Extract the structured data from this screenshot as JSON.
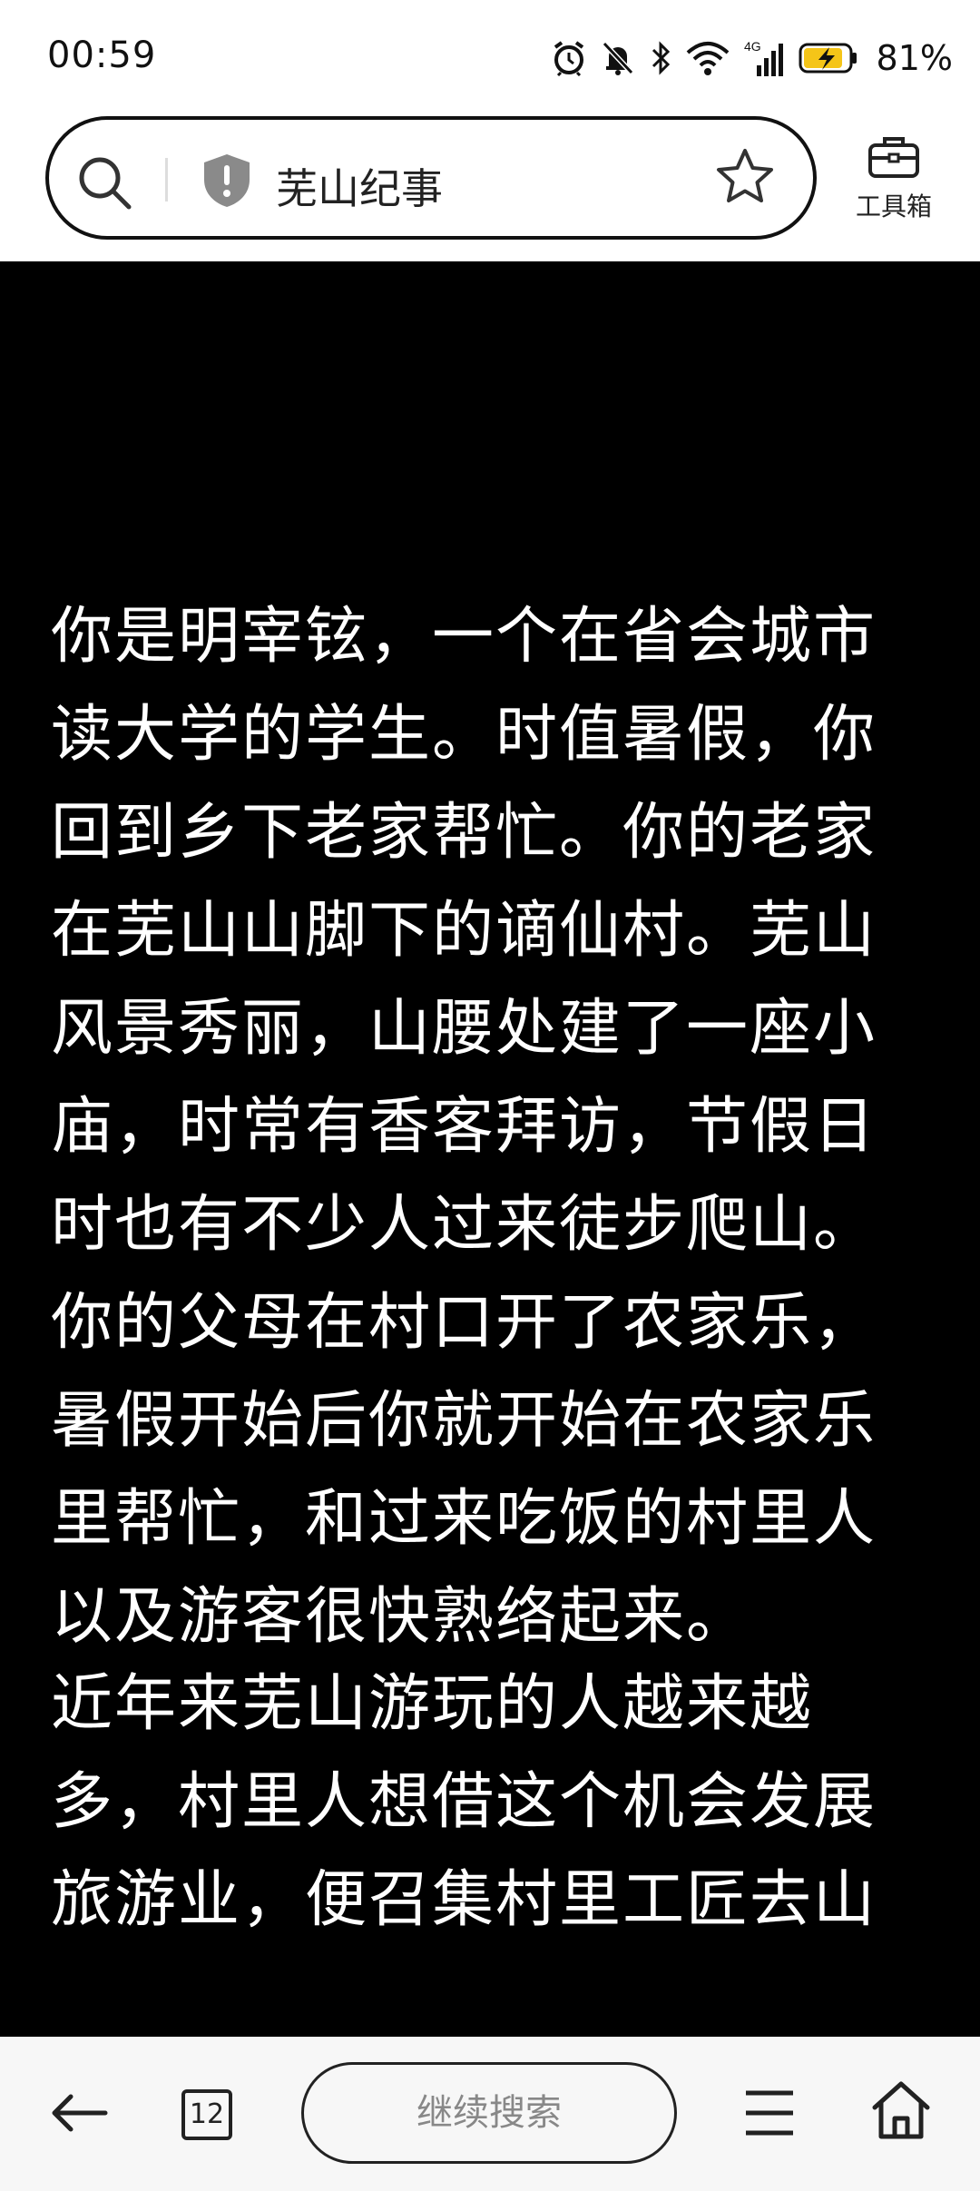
{
  "status_bar": {
    "time": "00:59",
    "network": "4G",
    "battery_percent": "81%"
  },
  "address_bar": {
    "page_title": "芜山纪事",
    "toolbox_label": "工具箱"
  },
  "article": {
    "paragraphs": [
      "你是明宰铉，一个在省会城市读大学的学生。时值暑假，你回到乡下老家帮忙。你的老家在芜山山脚下的谪仙村。芜山风景秀丽，山腰处建了一座小庙，时常有香客拜访，节假日时也有不少人过来徒步爬山。你的父母在村口开了农家乐，暑假开始后你就开始在农家乐里帮忙，和过来吃饭的村里人以及游客很快熟络起来。",
      "近年来芜山游玩的人越来越多，村里人想借这个机会发展旅游业，便召集村里工匠去山"
    ]
  },
  "bottom_nav": {
    "tab_count": "12",
    "continue_search_label": "继续搜索"
  }
}
